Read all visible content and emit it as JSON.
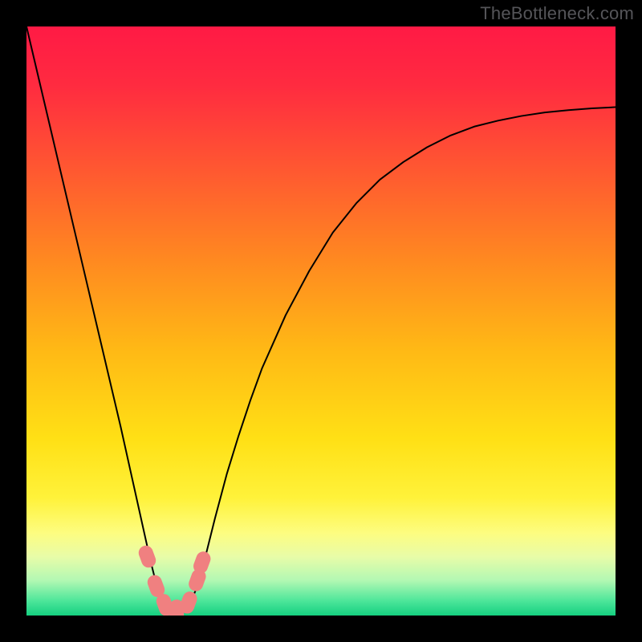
{
  "attribution": "TheBottleneck.com",
  "chart_data": {
    "type": "line",
    "title": "",
    "xlabel": "",
    "ylabel": "",
    "xlim": [
      0,
      100
    ],
    "ylim": [
      0,
      100
    ],
    "grid": false,
    "legend": false,
    "background": {
      "gradient_stops": [
        {
          "pos": 0.0,
          "color": "#ff1a45"
        },
        {
          "pos": 0.1,
          "color": "#ff2b40"
        },
        {
          "pos": 0.25,
          "color": "#ff5a30"
        },
        {
          "pos": 0.4,
          "color": "#ff8a20"
        },
        {
          "pos": 0.55,
          "color": "#ffb915"
        },
        {
          "pos": 0.7,
          "color": "#ffe015"
        },
        {
          "pos": 0.8,
          "color": "#fff23a"
        },
        {
          "pos": 0.86,
          "color": "#fdfd80"
        },
        {
          "pos": 0.9,
          "color": "#e8fca8"
        },
        {
          "pos": 0.94,
          "color": "#b3f8b3"
        },
        {
          "pos": 0.975,
          "color": "#4de69a"
        },
        {
          "pos": 1.0,
          "color": "#15d080"
        }
      ]
    },
    "series": [
      {
        "name": "bottleneck-curve",
        "stroke": "#000000",
        "stroke_width": 2,
        "x": [
          0.0,
          2.0,
          4.0,
          6.0,
          8.0,
          10.0,
          12.0,
          14.0,
          16.0,
          18.0,
          20.0,
          21.0,
          22.0,
          23.0,
          24.0,
          25.0,
          26.0,
          27.0,
          28.0,
          29.0,
          30.0,
          31.0,
          32.0,
          34.0,
          36.0,
          38.0,
          40.0,
          44.0,
          48.0,
          52.0,
          56.0,
          60.0,
          64.0,
          68.0,
          72.0,
          76.0,
          80.0,
          84.0,
          88.0,
          92.0,
          96.0,
          100.0
        ],
        "values": [
          100.0,
          91.5,
          83.0,
          74.5,
          66.0,
          57.5,
          49.0,
          40.5,
          32.0,
          23.0,
          14.0,
          9.5,
          5.5,
          2.5,
          1.0,
          0.5,
          0.5,
          1.0,
          2.5,
          5.0,
          8.5,
          12.5,
          16.5,
          24.0,
          30.5,
          36.5,
          42.0,
          51.0,
          58.5,
          65.0,
          70.0,
          74.0,
          77.0,
          79.5,
          81.5,
          83.0,
          84.0,
          84.8,
          85.4,
          85.8,
          86.1,
          86.3
        ]
      }
    ],
    "markers": [
      {
        "name": "pink-marker",
        "x": 20.5,
        "y": 10.0,
        "color": "#f08080"
      },
      {
        "name": "pink-marker",
        "x": 22.0,
        "y": 5.0,
        "color": "#f08080"
      },
      {
        "name": "pink-marker",
        "x": 23.5,
        "y": 1.8,
        "color": "#f08080"
      },
      {
        "name": "pink-marker",
        "x": 25.5,
        "y": 0.8,
        "color": "#f08080"
      },
      {
        "name": "pink-marker",
        "x": 27.5,
        "y": 2.2,
        "color": "#f08080"
      },
      {
        "name": "pink-marker",
        "x": 29.0,
        "y": 6.0,
        "color": "#f08080"
      },
      {
        "name": "pink-marker",
        "x": 29.8,
        "y": 9.0,
        "color": "#f08080"
      }
    ]
  }
}
